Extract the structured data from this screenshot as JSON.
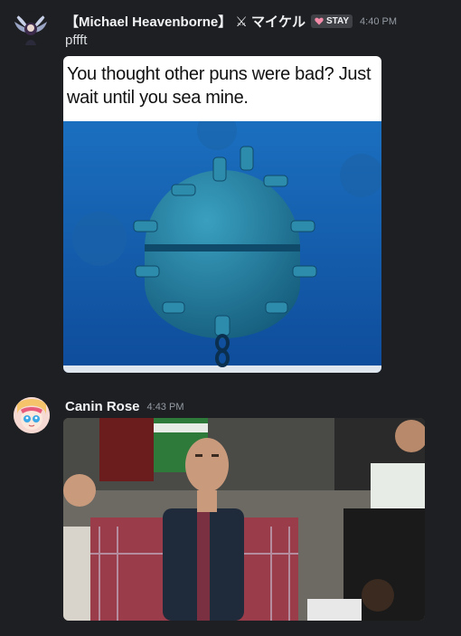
{
  "messages": [
    {
      "username": "【Michael Heavenborne】 ⚔ マイケル",
      "badge": {
        "label": "STAY",
        "icon": "heart-icon",
        "color": "#f38ba8"
      },
      "timestamp": "4:40 PM",
      "text": "pffft",
      "attachment": {
        "caption": "You thought other puns were bad? Just wait until you sea mine.",
        "image": "sea-mine-underwater-photo"
      }
    },
    {
      "username": "Canin Rose",
      "timestamp": "4:43 PM",
      "attachment": {
        "image": "disappointed-cricket-fan-photo"
      }
    }
  ],
  "colors": {
    "background": "#1e1f22",
    "username": "#f2f3f5",
    "timestamp": "#949ba4",
    "text": "#dbdee1"
  }
}
